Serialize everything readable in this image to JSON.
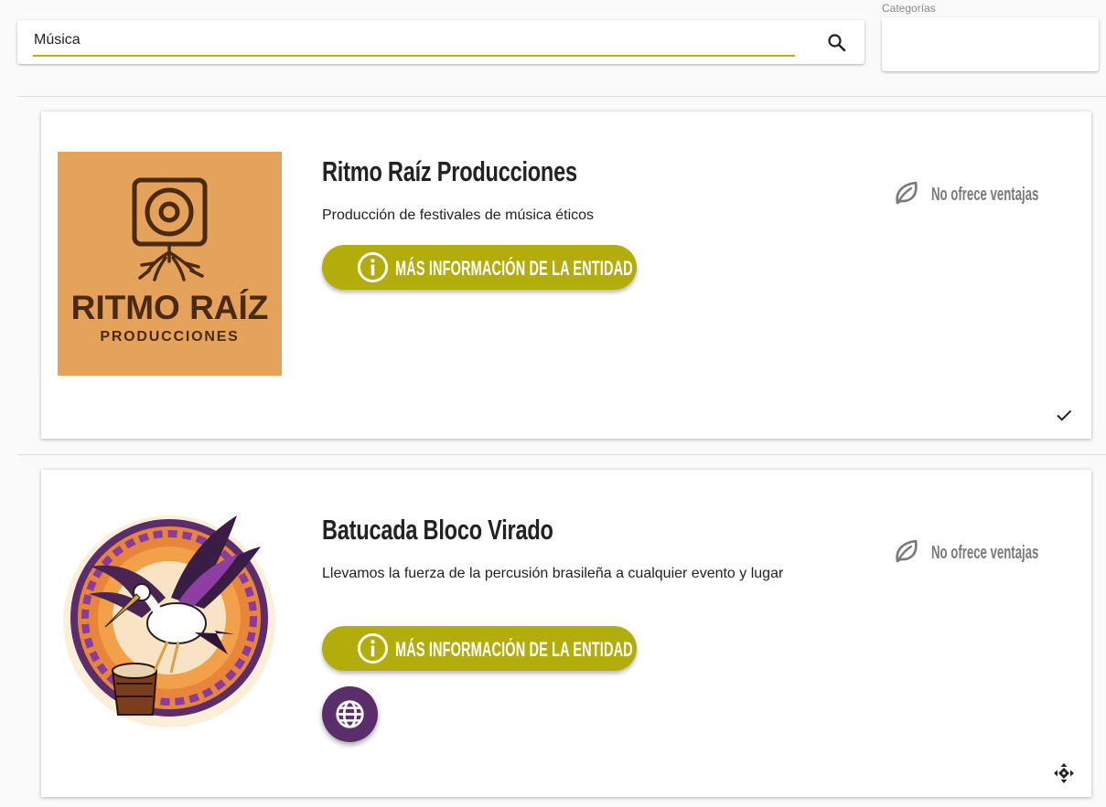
{
  "search": {
    "value": "Música",
    "search_icon": "search-icon"
  },
  "categories": {
    "label": "Categorías",
    "selected": ""
  },
  "colors": {
    "accent": "#b3ad0b",
    "web_button": "#5a2e6b",
    "logo_bg": "#e5a25a",
    "logo_ink": "#4b2a14"
  },
  "entities": [
    {
      "name": "Ritmo Raíz Producciones",
      "description": "Producción de festivales de música éticos",
      "info_button": "MÁS INFORMACIÓN DE LA ENTIDAD",
      "benefits": "No ofrece ventajas",
      "logo": {
        "line1": "RITMO RAÍZ",
        "line2": "PRODUCCIONES"
      },
      "corner_icon": "check-icon"
    },
    {
      "name": "Batucada Bloco Virado",
      "description": "Llevamos la fuerza de la percusión brasileña a cualquier evento y lugar",
      "info_button": "MÁS INFORMACIÓN DE LA ENTIDAD",
      "benefits": "No ofrece ventajas",
      "website_icon": "globe-icon",
      "corner_icon": "diamond-arrows-icon"
    }
  ]
}
